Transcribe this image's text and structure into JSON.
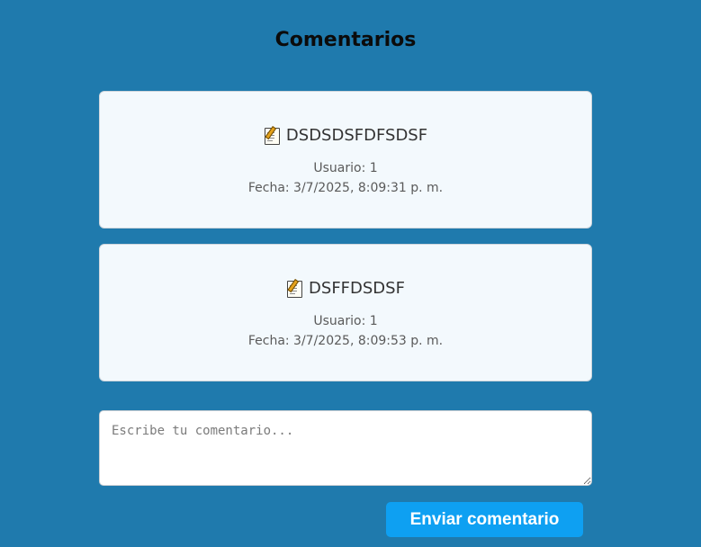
{
  "page": {
    "title": "Comentarios"
  },
  "comments": [
    {
      "icon": "memo-icon",
      "text": "DSDSDSFDFSDSF",
      "user": "Usuario: 1",
      "date": "Fecha: 3/7/2025, 8:09:31 p. m."
    },
    {
      "icon": "memo-icon",
      "text": "DSFFDSDSF",
      "user": "Usuario: 1",
      "date": "Fecha: 3/7/2025, 8:09:53 p. m."
    }
  ],
  "form": {
    "placeholder": "Escribe tu comentario...",
    "value": "",
    "submit_label": "Enviar comentario"
  },
  "colors": {
    "background": "#1f7aad",
    "card": "#f3f9fd",
    "button": "#0ea0f2"
  }
}
